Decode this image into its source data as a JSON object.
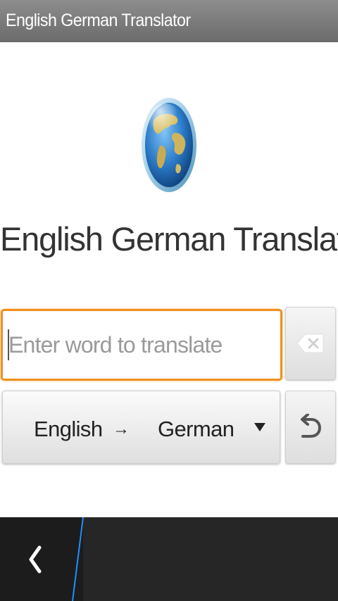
{
  "titlebar": {
    "title": "English German Translator"
  },
  "main": {
    "logo_icon": "globe-icon",
    "app_title": "English German Translator",
    "input": {
      "value": "",
      "placeholder": "Enter word to translate"
    },
    "clear_icon": "backspace-clear-icon",
    "language": {
      "from": "English",
      "arrow": "→",
      "to": "German",
      "dropdown_icon": "dropdown-triangle-icon"
    },
    "swap_icon": "undo-arrow-icon"
  },
  "bottombar": {
    "back_icon": "chevron-left-icon",
    "accent_color": "#1e90ff"
  },
  "colors": {
    "titlebar": "#7a7a7a",
    "input_focus": "#f08f1e",
    "bottombar": "#262626"
  }
}
